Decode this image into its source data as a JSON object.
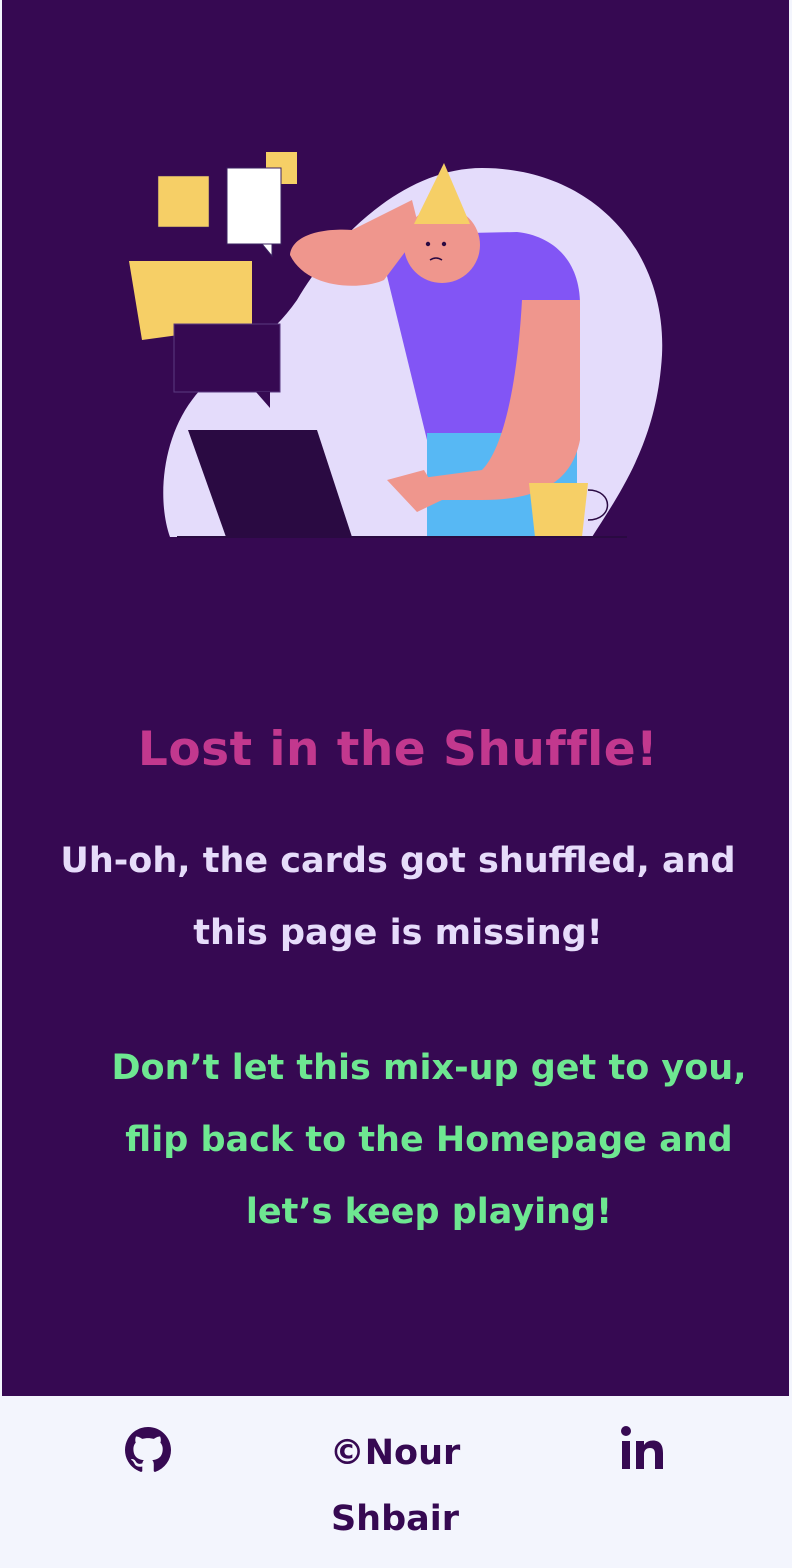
{
  "page": {
    "title": "Lost in the Shuffle!",
    "subtitle": "Uh-oh, the cards got shuffled, and this page is missing!",
    "cta": {
      "before": "Don’t let this mix-up get to you, flip back to the ",
      "link": "Homepage",
      "after": " and let’s keep playing!"
    }
  },
  "footer": {
    "copyright": "©Nour Shbair",
    "github_icon": "github-icon",
    "linkedin_icon": "linkedin-icon"
  },
  "colors": {
    "background": "#360952",
    "title": "#c2388e",
    "subtitle": "#e6dcfa",
    "cta": "#6ee791",
    "footer_bg": "#f3f5fd"
  }
}
